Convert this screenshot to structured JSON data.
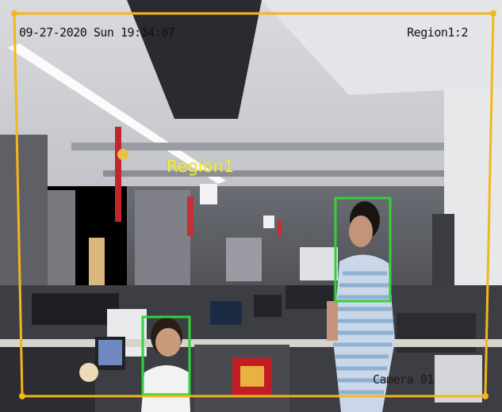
{
  "osd": {
    "datetime": "09-27-2020 Sun 19:34:07",
    "region_count": "Region1:2",
    "camera": "Camera 01"
  },
  "region": {
    "label": "Region1",
    "color": "#f3b71d"
  },
  "detection": {
    "color": "#31d23a"
  }
}
